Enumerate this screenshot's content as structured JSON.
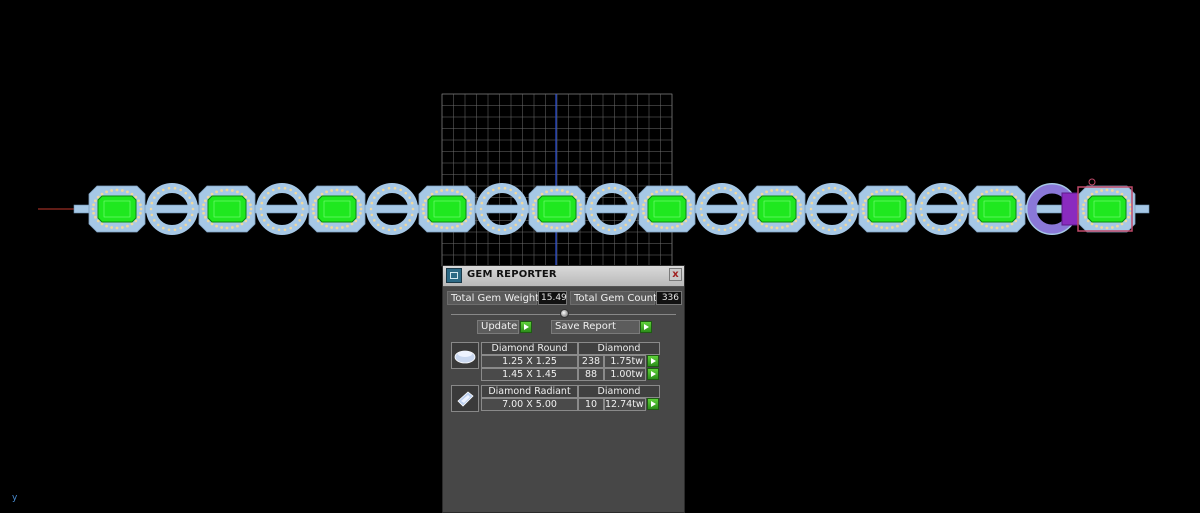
{
  "panel": {
    "title": "GEM REPORTER",
    "close_label": "x",
    "total_weight_label": "Total Gem Weight",
    "total_weight_value": "15.49",
    "total_count_label": "Total Gem Count",
    "total_count_value": "336",
    "update_label": "Update",
    "save_report_label": "Save Report",
    "gems": [
      {
        "name": "Diamond Round",
        "material": "Diamond",
        "shape_icon": "round-gem-icon",
        "rows": [
          {
            "size": "1.25 X 1.25",
            "count": "238",
            "weight": "1.75tw"
          },
          {
            "size": "1.45 X 1.45",
            "count": "88",
            "weight": "1.00tw"
          }
        ]
      },
      {
        "name": "Diamond Radiant",
        "material": "Diamond",
        "shape_icon": "radiant-gem-icon",
        "rows": [
          {
            "size": "7.00 X 5.00",
            "count": "10",
            "weight": "12.74tw"
          }
        ]
      }
    ]
  },
  "viewport": {
    "axis_label": "y",
    "colors": {
      "background": "#000000",
      "emerald": "#1fe81f",
      "metal": "#a6c8e6",
      "clasp": "#8a2bbf",
      "grid": "#9a9a9a"
    }
  }
}
